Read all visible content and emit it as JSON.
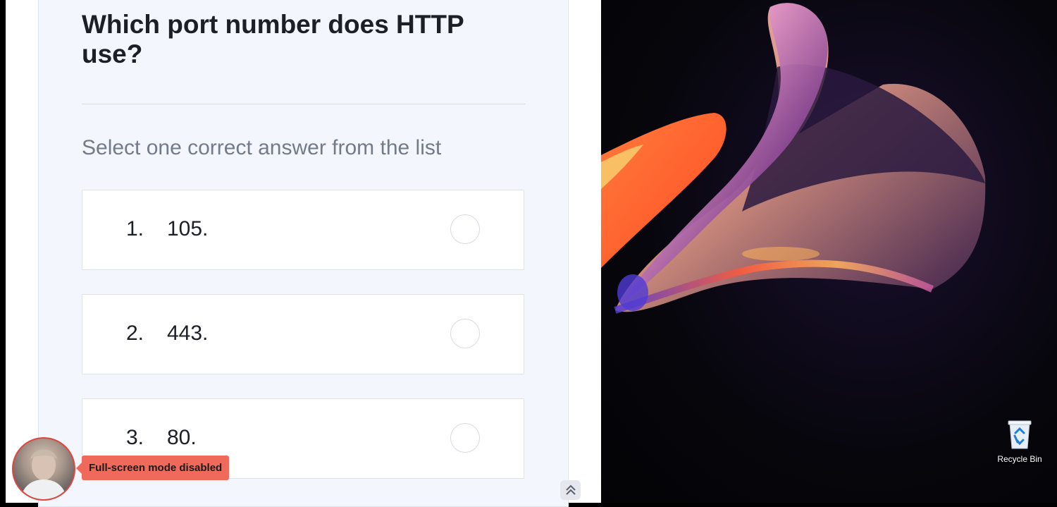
{
  "question": {
    "title": "Which port number does HTTP use?"
  },
  "instruction": "Select one correct answer from the list",
  "options": [
    {
      "number": "1.",
      "text": "105."
    },
    {
      "number": "2.",
      "text": "443."
    },
    {
      "number": "3.",
      "text": "80."
    }
  ],
  "proctor": {
    "notice": "Full-screen mode disabled"
  },
  "desktop": {
    "recycle_bin_label": "Recycle Bin"
  },
  "icons": {
    "scroll_up": "double-chevron-up-icon",
    "recycle_bin": "recycle-bin-icon",
    "avatar": "webcam-avatar"
  }
}
